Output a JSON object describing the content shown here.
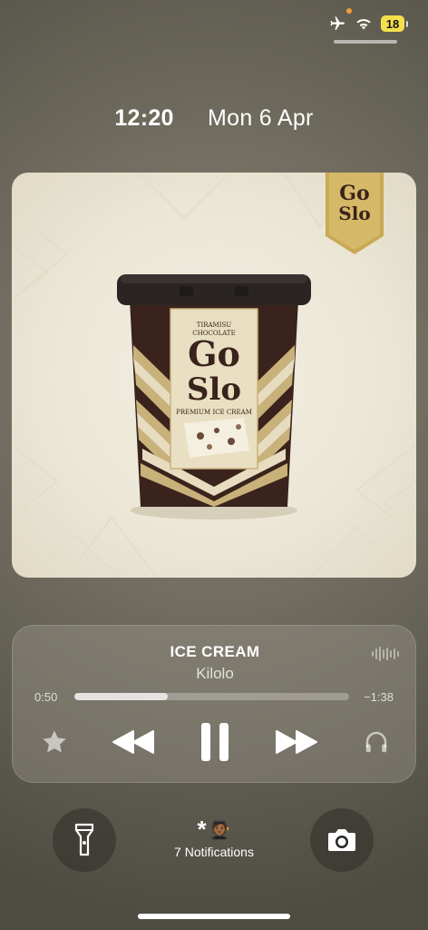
{
  "status_bar": {
    "battery_level": "18",
    "icons": [
      "airplane-icon",
      "wifi-icon",
      "battery-icon"
    ],
    "indicator_color": "#f0a030"
  },
  "lock_screen": {
    "time": "12:20",
    "date": "Mon 6 Apr"
  },
  "artwork": {
    "brand_line1": "Go",
    "brand_line2": "Slo",
    "flavor_line1": "TIRAMISU",
    "flavor_line2": "CHOCOLATE",
    "product_type": "PREMIUM ICE CREAM"
  },
  "now_playing": {
    "title": "ICE CREAM",
    "artist": "Kilolo",
    "elapsed": "0:50",
    "remaining": "−1:38",
    "progress": 0.34,
    "controls": [
      "star-icon",
      "rewind-icon",
      "pause-icon",
      "fast-forward-icon",
      "airplay-headphones-icon"
    ]
  },
  "notifications": {
    "label": "7 Notifications",
    "emoji": "🧑🏾‍🎓"
  },
  "colors": {
    "accent_battery": "#f4e04d",
    "tub_dark": "#3a231c",
    "tub_gold": "#c9b27a"
  }
}
